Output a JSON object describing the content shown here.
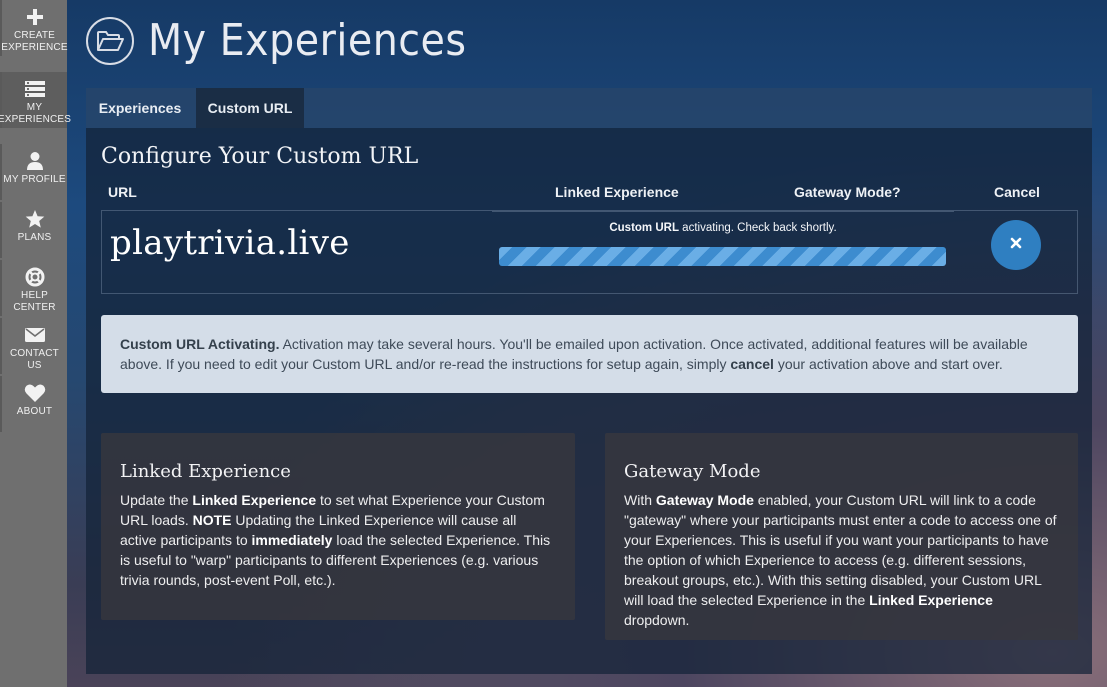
{
  "sidebar": {
    "items": [
      {
        "label": "CREATE\nEXPERIENCE",
        "icon": "plus-icon"
      },
      {
        "label": "MY\nEXPERIENCES",
        "icon": "list-icon"
      },
      {
        "label": "MY PROFILE",
        "icon": "user-icon"
      },
      {
        "label": "PLANS",
        "icon": "star-icon"
      },
      {
        "label": "HELP CENTER",
        "icon": "lifebuoy-icon"
      },
      {
        "label": "CONTACT US",
        "icon": "envelope-icon"
      },
      {
        "label": "ABOUT",
        "icon": "heart-icon"
      }
    ]
  },
  "header": {
    "title": "My Experiences",
    "icon": "folder-open-icon"
  },
  "tabs": [
    {
      "label": "Experiences",
      "active": false
    },
    {
      "label": "Custom URL",
      "active": true
    }
  ],
  "config": {
    "title": "Configure Your Custom URL",
    "columns": {
      "url": "URL",
      "linked": "Linked Experience",
      "gateway": "Gateway Mode?",
      "cancel": "Cancel"
    },
    "url": "playtrivia.live",
    "status_bold": "Custom URL",
    "status_rest": " activating. Check back shortly.",
    "progress_percent": 100
  },
  "notice": {
    "bold": "Custom URL Activating.",
    "text1": " Activation may take several hours. You'll be emailed upon activation. Once activated, additional features will be available above. If you need to edit your Custom URL and/or re-read the instructions for setup again, simply ",
    "bold2": "cancel",
    "text2": " your activation above and start over."
  },
  "linked_card": {
    "title": "Linked Experience",
    "p1": "Update the ",
    "b1": "Linked Experience",
    "p2": " to set what Experience your Custom URL loads. ",
    "b2": "NOTE",
    "p3": " Updating the Linked Experience will cause all active participants to ",
    "b3": "immediately",
    "p4": " load the selected Experience. This is useful to \"warp\" participants to different Experiences (e.g. various trivia rounds, post-event Poll, etc.)."
  },
  "gateway_card": {
    "title": "Gateway Mode",
    "p1": "With ",
    "b1": "Gateway Mode",
    "p2": " enabled, your Custom URL will link to a code \"gateway\" where your participants must enter a code to access one of your Experiences. This is useful if you want your participants to have the option of which Experience to access (e.g. different sessions, breakout groups, etc.). With this setting disabled, your Custom URL will load the selected Experience in the ",
    "b2": "Linked Experience",
    "p3": " dropdown."
  },
  "colors": {
    "sidebar": "#6f6f6f",
    "accent": "#2f7fc1",
    "notice_bg": "#d4dde8"
  }
}
